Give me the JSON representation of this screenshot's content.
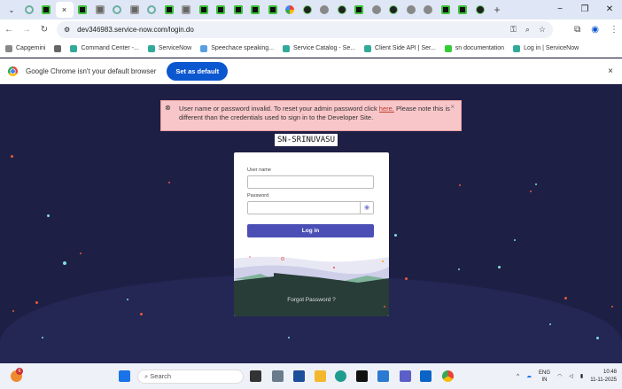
{
  "browser": {
    "tabs": [
      "ring",
      "sn",
      "active",
      "sn",
      "gr",
      "ring",
      "gr",
      "ring",
      "sn",
      "gr",
      "sn",
      "sn",
      "sn",
      "sn",
      "sn",
      "g",
      "dark",
      "globe",
      "dark",
      "sn",
      "globe",
      "dark",
      "globe",
      "globe",
      "sn",
      "sn",
      "dark"
    ],
    "active_tab_close": "×",
    "new_tab": "+",
    "window_controls": {
      "minimize": "−",
      "restore": "❐",
      "close": "✕"
    },
    "url": "dev346983.service-now.com/login.do",
    "bookmarks": [
      {
        "label": "Capgemini",
        "icon": "folder-icon"
      },
      {
        "label": "",
        "icon": "apps-icon"
      },
      {
        "label": "Command Center -...",
        "icon": "servicenow-icon"
      },
      {
        "label": "ServiceNow",
        "icon": "servicenow-icon"
      },
      {
        "label": "Speechace speaking...",
        "icon": "speechace-icon"
      },
      {
        "label": "Service Catalog - Se...",
        "icon": "servicenow-icon"
      },
      {
        "label": "Client Side API | Ser...",
        "icon": "servicenow-icon"
      },
      {
        "label": "sn documentation",
        "icon": "doc-icon"
      },
      {
        "label": "Log in | ServiceNow",
        "icon": "servicenow-icon"
      }
    ],
    "infobar": {
      "message": "Google Chrome isn't your default browser",
      "button": "Set as default",
      "close": "×"
    }
  },
  "page": {
    "alert": {
      "text_before": "User name or password invalid. To reset your admin password click ",
      "link": "here.",
      "text_after": " Please note this is different than the credentials used to sign in to the Developer Site.",
      "close": "×"
    },
    "instance_name": "SN-SRINUVASU",
    "form": {
      "username_label": "User name",
      "username_value": "",
      "password_label": "Password",
      "password_value": "",
      "login_button": "Log in",
      "forgot_link": "Forgot Password ?"
    }
  },
  "taskbar": {
    "search_placeholder": "Search",
    "weather_badge": "6",
    "lang": "ENG",
    "region": "IN",
    "time": "10:48",
    "date": "11-11-2025"
  },
  "colors": {
    "background": "#1e1f45",
    "alert": "#f8c6c9",
    "login": "#4b4fb5",
    "accent": "#0b57d0"
  }
}
